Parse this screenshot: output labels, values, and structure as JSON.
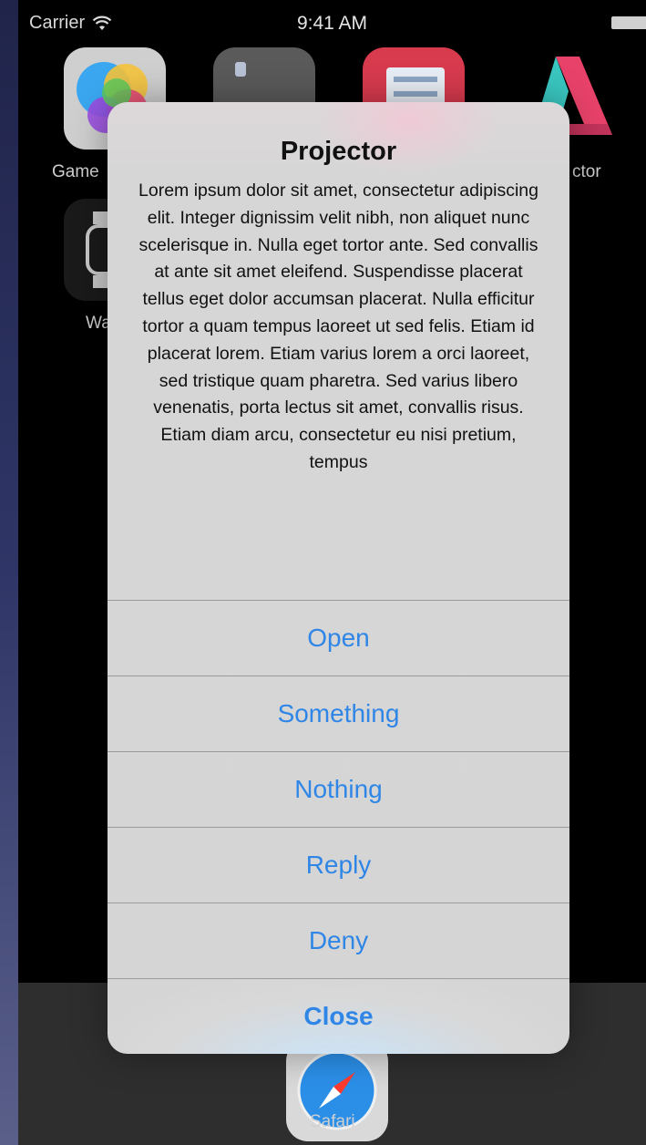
{
  "status_bar": {
    "carrier": "Carrier",
    "time": "9:41 AM"
  },
  "home": {
    "apps": [
      {
        "label": "Game"
      },
      {
        "label": "ctor"
      },
      {
        "label": "Wa"
      }
    ],
    "dock": {
      "label": "Safari"
    }
  },
  "alert": {
    "title": "Projector",
    "message": "Lorem ipsum dolor sit amet, consectetur adipiscing elit. Integer dignissim velit nibh, non aliquet nunc scelerisque in. Nulla eget tortor ante. Sed convallis at ante sit amet eleifend. Suspendisse placerat tellus eget dolor accumsan placerat. Nulla efficitur tortor a quam tempus laoreet ut sed felis. Etiam id placerat lorem. Etiam varius lorem a orci laoreet, sed tristique quam pharetra. Sed varius libero venenatis, porta lectus sit amet, convallis risus. Etiam diam arcu, consectetur eu nisi pretium, tempus",
    "actions": [
      "Open",
      "Something",
      "Nothing",
      "Reply",
      "Deny",
      "Close"
    ]
  },
  "colors": {
    "action_blue": "#2f86e6",
    "alert_bg": "#d5d5d5"
  }
}
